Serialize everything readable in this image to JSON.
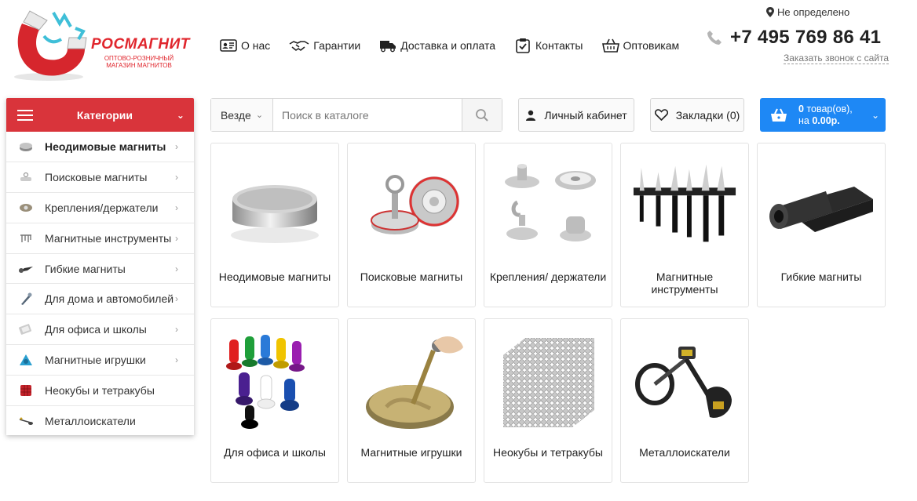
{
  "brand": {
    "title": "РОСМАГНИТ",
    "subtitle_line1": "оптово-розничный",
    "subtitle_line2": "магазин магнитов",
    "accent": "#e0262d"
  },
  "topnav": [
    {
      "label": "О нас",
      "icon": "id-card-icon"
    },
    {
      "label": "Гарантии",
      "icon": "handshake-icon"
    },
    {
      "label": "Доставка и оплата",
      "icon": "truck-icon"
    },
    {
      "label": "Контакты",
      "icon": "clipboard-check-icon"
    },
    {
      "label": "Оптовикам",
      "icon": "basket-icon"
    }
  ],
  "header": {
    "location": "Не определено",
    "phone": "+7 495 769 86 41",
    "callback": "Заказать звонок с сайта"
  },
  "categories": {
    "title": "Категории",
    "header_color": "#d9343b",
    "items": [
      {
        "label": "Неодимовые магниты",
        "icon": "disc-magnet-icon",
        "has_sub": true
      },
      {
        "label": "Поисковые магниты",
        "icon": "search-magnet-icon",
        "has_sub": true
      },
      {
        "label": "Крепления/держатели",
        "icon": "holder-icon",
        "has_sub": true
      },
      {
        "label": "Магнитные инструменты",
        "icon": "tools-icon",
        "has_sub": true
      },
      {
        "label": "Гибкие магниты",
        "icon": "flexible-magnet-icon",
        "has_sub": true
      },
      {
        "label": "Для дома и автомобилей",
        "icon": "car-home-icon",
        "has_sub": true
      },
      {
        "label": "Для офиса и школы",
        "icon": "office-icon",
        "has_sub": true
      },
      {
        "label": "Магнитные игрушки",
        "icon": "toy-icon",
        "has_sub": true
      },
      {
        "label": "Неокубы и тетракубы",
        "icon": "neocube-icon",
        "has_sub": false
      },
      {
        "label": "Металлоискатели",
        "icon": "metal-detector-icon",
        "has_sub": false
      }
    ]
  },
  "search": {
    "scope": "Везде",
    "placeholder": "Поиск в каталоге"
  },
  "account": {
    "label": "Личный кабинет"
  },
  "bookmarks": {
    "label": "Закладки (0)"
  },
  "cart": {
    "count": "0",
    "count_suffix": " товар(ов),",
    "sum_prefix": "на ",
    "sum": "0.00р.",
    "color": "#1e88f5"
  },
  "products": [
    {
      "name": "Неодимовые магниты",
      "image": "neodymium-disc-image"
    },
    {
      "name": "Поисковые магниты",
      "image": "search-magnet-image"
    },
    {
      "name": "Крепления/ держатели",
      "image": "holders-image"
    },
    {
      "name": "Магнитные инструменты",
      "image": "knife-strip-image"
    },
    {
      "name": "Гибкие магниты",
      "image": "flex-roll-image"
    },
    {
      "name": "Для офиса и школы",
      "image": "office-pins-image"
    },
    {
      "name": "Магнитные игрушки",
      "image": "putty-image"
    },
    {
      "name": "Неокубы и тетракубы",
      "image": "neocube-image"
    },
    {
      "name": "Металлоискатели",
      "image": "detector-image"
    }
  ]
}
